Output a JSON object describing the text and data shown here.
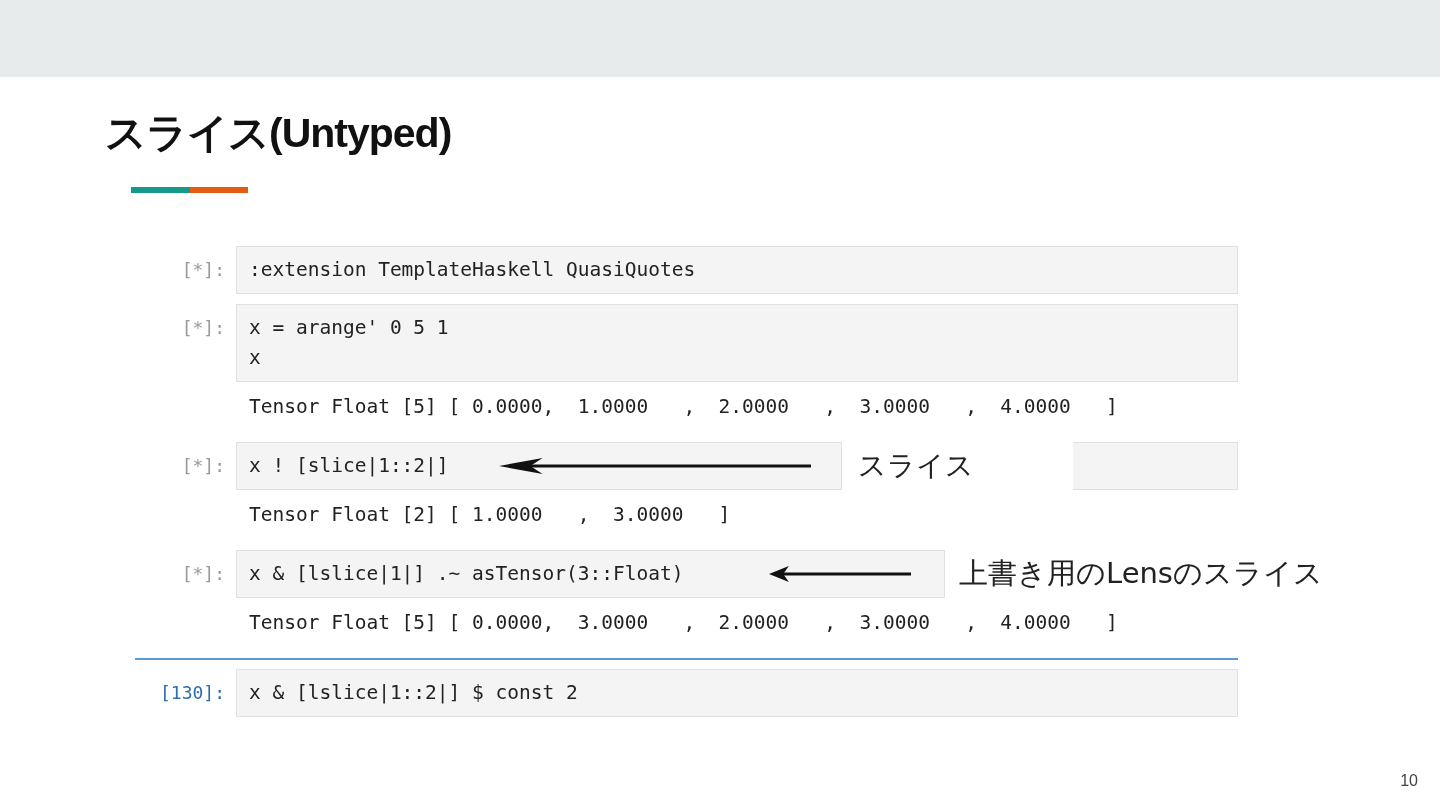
{
  "slide": {
    "title": "スライス(Untyped)",
    "page_number": "10"
  },
  "cells": [
    {
      "prompt": "[*]:",
      "selected": false,
      "code": [
        ":extension TemplateHaskell QuasiQuotes"
      ]
    },
    {
      "prompt": "[*]:",
      "selected": false,
      "code": [
        "x = arange' 0 5 1",
        "x"
      ],
      "output": "Tensor Float [5] [ 0.0000,  1.0000   ,  2.0000   ,  3.0000   ,  4.0000   ]"
    },
    {
      "prompt": "[*]:",
      "selected": false,
      "code": [
        "x ! [slice|1::2|]"
      ],
      "output": "Tensor Float [2] [ 1.0000   ,  3.0000   ]",
      "annotation": "スライス"
    },
    {
      "prompt": "[*]:",
      "selected": false,
      "code": [
        "x & [lslice|1|] .~ asTensor(3::Float)"
      ],
      "output": "Tensor Float [5] [ 0.0000,  3.0000   ,  2.0000   ,  3.0000   ,  4.0000   ]",
      "annotation": "上書き用のLensのスライス"
    },
    {
      "prompt": "[130]:",
      "selected": true,
      "code": [
        "x & [lslice|1::2|] $ const 2"
      ]
    }
  ]
}
